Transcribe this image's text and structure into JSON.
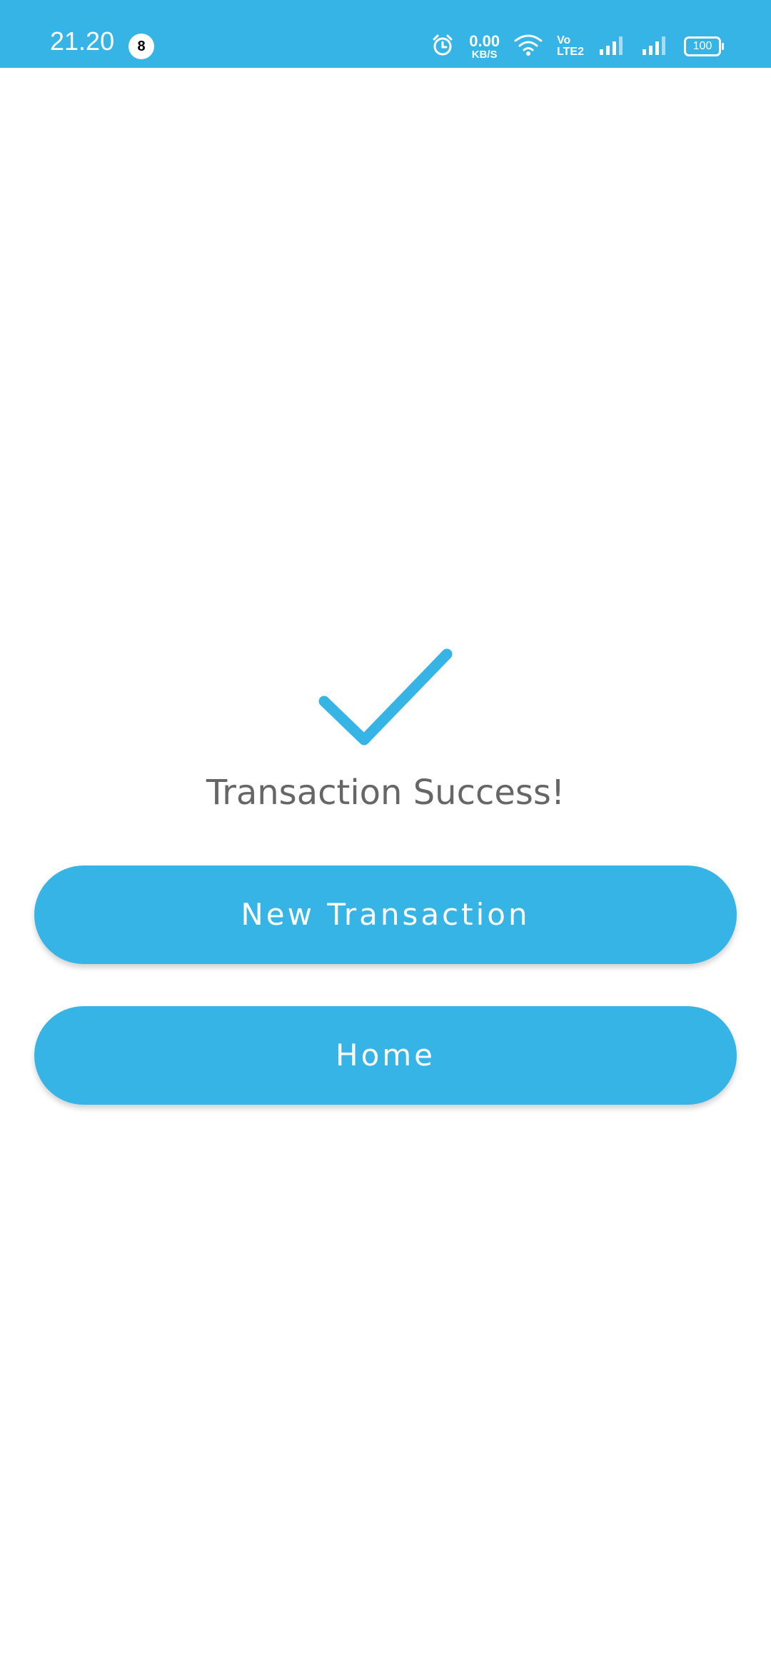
{
  "status_bar": {
    "time": "21.20",
    "notification_count": "8",
    "net_speed_value": "0.00",
    "net_speed_unit": "KB/S",
    "volte_top": "Vo",
    "volte_bottom": "LTE2",
    "battery": "100",
    "icons": [
      "alarm-icon",
      "wifi-icon",
      "signal-icon",
      "signal-icon"
    ],
    "color": "#36b4e5"
  },
  "main": {
    "icon": "checkmark-icon",
    "title": "Transaction Success!",
    "title_color": "#666666",
    "buttons": {
      "new_transaction": "New Transaction",
      "home": "Home"
    },
    "accent": "#36b4e5"
  }
}
